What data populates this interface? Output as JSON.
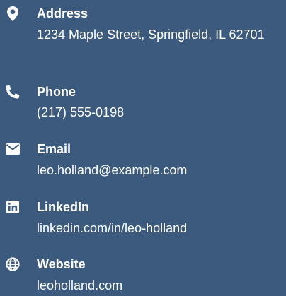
{
  "contacts": {
    "address": {
      "title": "Address",
      "value": "1234 Maple Street, Springfield, IL 62701",
      "icon": "map-pin-icon"
    },
    "phone": {
      "title": "Phone",
      "value": "(217) 555-0198",
      "icon": "phone-icon"
    },
    "email": {
      "title": "Email",
      "value": "leo.holland@example.com",
      "icon": "envelope-icon"
    },
    "linkedin": {
      "title": "LinkedIn",
      "value": "linkedin.com/in/leo-holland",
      "icon": "linkedin-icon"
    },
    "website": {
      "title": "Website",
      "value": "leoholland.com",
      "icon": "globe-icon"
    }
  },
  "colors": {
    "background": "#3c5a7e",
    "text": "#ffffff"
  }
}
